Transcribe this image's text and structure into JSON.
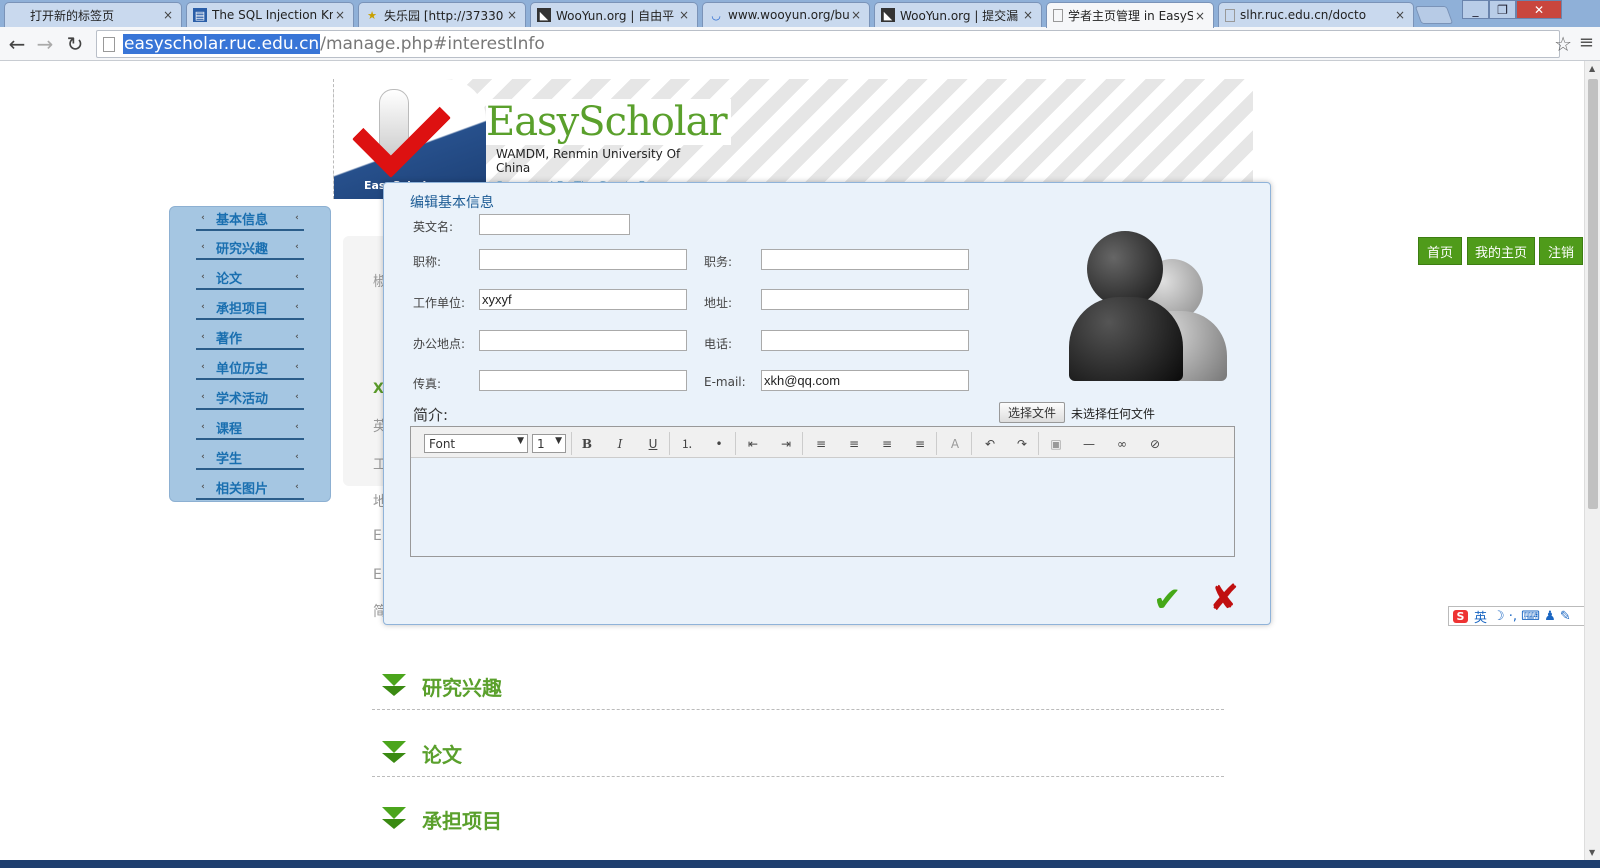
{
  "browser": {
    "tabs": [
      {
        "label": "打开新的标签页",
        "icon": "blank-icon"
      },
      {
        "label": "The SQL Injection Kn",
        "icon": "doc-icon"
      },
      {
        "label": "失乐园 [http://37330",
        "icon": "star-icon"
      },
      {
        "label": "WooYun.org | 自由平",
        "icon": "wooyun-icon"
      },
      {
        "label": "www.wooyun.org/bu",
        "icon": "loading-icon"
      },
      {
        "label": "WooYun.org | 提交漏",
        "icon": "wooyun-icon"
      },
      {
        "label": "学者主页管理 in EasyS",
        "icon": "page-icon"
      },
      {
        "label": "slhr.ruc.edu.cn/docto",
        "icon": "page-icon"
      }
    ],
    "close_glyph": "×",
    "address_host": "easyscholar.ruc.edu.cn",
    "address_path": "/manage.php#interestInfo",
    "back": "←",
    "forward": "→",
    "reload": "↻",
    "star": "☆",
    "menu": "≡",
    "win_min": "_",
    "win_max": "❐",
    "win_close": "✕"
  },
  "header": {
    "logo_text": "EasyScholar",
    "brand": "EasyScholar",
    "org": "WAMDM, Renmin University Of China",
    "support": "Supported By The Grants From"
  },
  "sidebar": {
    "chev": "‹",
    "items": [
      {
        "label": "基本信息"
      },
      {
        "label": "研究兴趣"
      },
      {
        "label": "论文"
      },
      {
        "label": "承担项目"
      },
      {
        "label": "著作"
      },
      {
        "label": "单位历史"
      },
      {
        "label": "学术活动"
      },
      {
        "label": "课程"
      },
      {
        "label": "学生"
      },
      {
        "label": "相关图片"
      }
    ]
  },
  "background": {
    "chars": [
      "椒",
      "X",
      "英",
      "工",
      "地",
      "E",
      "E",
      "简"
    ]
  },
  "topnav": {
    "home": "首页",
    "my_home": "我的主页",
    "logout": "注销"
  },
  "dialog": {
    "title": "编辑基本信息",
    "fields": {
      "english_name": {
        "label": "英文名:",
        "value": ""
      },
      "title": {
        "label": "职称:",
        "value": ""
      },
      "position": {
        "label": "职务:",
        "value": ""
      },
      "work_unit": {
        "label": "工作单位:",
        "value": "xyxyf"
      },
      "address": {
        "label": "地址:",
        "value": ""
      },
      "office": {
        "label": "办公地点:",
        "value": ""
      },
      "phone": {
        "label": "电话:",
        "value": ""
      },
      "fax": {
        "label": "传真:",
        "value": ""
      },
      "email": {
        "label": "E-mail:",
        "value": "xkh@qq.com"
      }
    },
    "intro_label": "简介:",
    "file_button": "选择文件",
    "file_status": "未选择任何文件",
    "editor": {
      "font_select": "Font",
      "size_select": "1",
      "select_arrow": "▼",
      "buttons": [
        "B",
        "I",
        "U",
        "⒈",
        "•",
        "⇤",
        "⇥",
        "≡",
        "≡",
        "≡",
        "≡",
        "A",
        "↶",
        "↷",
        "▣",
        "—",
        "∞",
        "⊘"
      ]
    },
    "ok": "✔",
    "cancel": "✘"
  },
  "sections": [
    {
      "title": "研究兴趣"
    },
    {
      "title": "论文"
    },
    {
      "title": "承担项目"
    }
  ],
  "ime": {
    "logo": "S",
    "mode": "英",
    "icons": "☽ ·, ⌨ ♟ ✎"
  }
}
